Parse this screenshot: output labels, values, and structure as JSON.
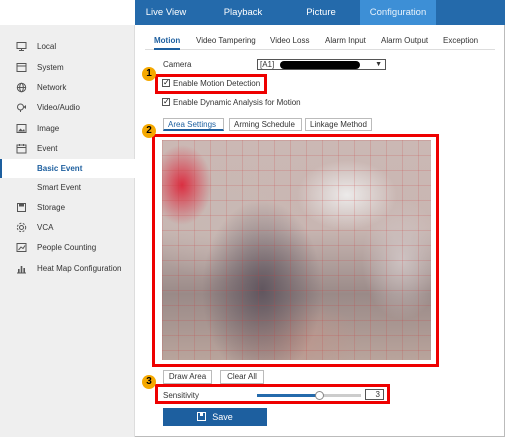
{
  "topnav": {
    "items": [
      "Live View",
      "Playback",
      "Picture",
      "Configuration"
    ],
    "active": "Configuration"
  },
  "sidebar": {
    "items": [
      {
        "label": "Local",
        "icon": "monitor-icon"
      },
      {
        "label": "System",
        "icon": "system-icon"
      },
      {
        "label": "Network",
        "icon": "globe-icon"
      },
      {
        "label": "Video/Audio",
        "icon": "video-audio-icon"
      },
      {
        "label": "Image",
        "icon": "image-icon"
      },
      {
        "label": "Event",
        "icon": "calendar-icon"
      },
      {
        "label": "Basic Event",
        "icon": ""
      },
      {
        "label": "Smart Event",
        "icon": ""
      },
      {
        "label": "Storage",
        "icon": "storage-icon"
      },
      {
        "label": "VCA",
        "icon": "vca-icon"
      },
      {
        "label": "People Counting",
        "icon": "people-counting-icon"
      },
      {
        "label": "Heat Map Configuration",
        "icon": "bar-chart-icon"
      }
    ],
    "active": "Basic Event"
  },
  "tabs": [
    "Motion",
    "Video Tampering",
    "Video Loss",
    "Alarm Input",
    "Alarm Output",
    "Exception"
  ],
  "active_tab": "Motion",
  "camera": {
    "label": "Camera",
    "value": "[A1]"
  },
  "checkboxes": {
    "motion_detection": {
      "label": "Enable Motion Detection",
      "checked": true
    },
    "dynamic_analysis": {
      "label": "Enable Dynamic Analysis for Motion",
      "checked": true
    }
  },
  "subtabs": [
    "Area Settings",
    "Arming Schedule",
    "Linkage Method"
  ],
  "active_subtab": "Area Settings",
  "buttons": {
    "draw_area": "Draw Area",
    "clear_all": "Clear All",
    "save": "Save"
  },
  "sensitivity": {
    "label": "Sensitivity",
    "value": "3",
    "level": 0.6
  },
  "annotations": [
    "1",
    "2",
    "3"
  ],
  "colors": {
    "accent": "#246aab",
    "highlight": "#e00000",
    "badge": "#f5a800"
  }
}
